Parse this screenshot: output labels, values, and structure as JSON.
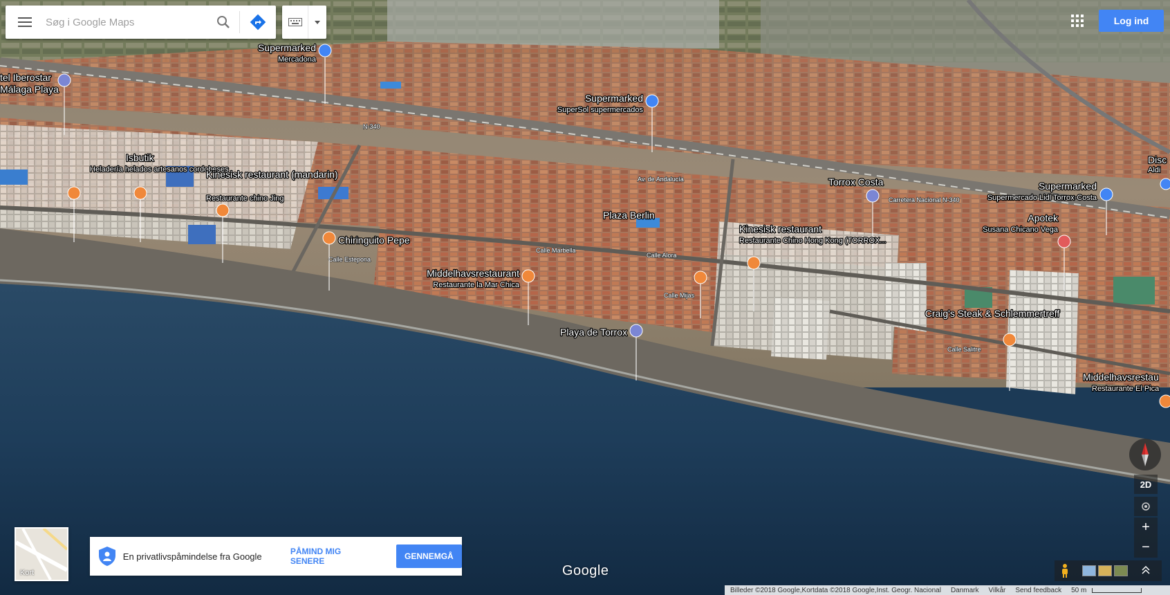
{
  "search": {
    "placeholder": "Søg i Google Maps"
  },
  "header": {
    "signin_label": "Log ind"
  },
  "pois": [
    {
      "name": "Supermarked",
      "sub": "Mercadona",
      "type": "shop"
    },
    {
      "name": "tel Iberostar",
      "sub": "Málaga Playa",
      "type": "hotel"
    },
    {
      "name": "Supermarked",
      "sub": "SuperSol supermercados",
      "type": "shop"
    },
    {
      "name": "Isbutik",
      "sub": "Heladería helados artesanos cordobeses",
      "type": "food"
    },
    {
      "name": "Kinesisk restaurant (mandarin)",
      "sub": "Restaurante chino Jing",
      "type": "food"
    },
    {
      "name": "Chiringuito Pepe",
      "sub": "",
      "type": "food"
    },
    {
      "name": "Middelhavsrestaurant",
      "sub": "Restaurante la Mar Chica",
      "type": "food"
    },
    {
      "name": "Plaza Berlin",
      "sub": "",
      "type": "place"
    },
    {
      "name": "Torrox Costa",
      "sub": "",
      "type": "hotel"
    },
    {
      "name": "Kinesisk restaurant",
      "sub": "Restaurante Chino Hong Kong (TORROX...",
      "type": "food"
    },
    {
      "name": "Playa de Torrox",
      "sub": "",
      "type": "beach"
    },
    {
      "name": "Supermarked",
      "sub": "Supermercado Lidl Torrox-Costa",
      "type": "shop"
    },
    {
      "name": "Apotek",
      "sub": "Susana Chicano Vega",
      "type": "pharmacy"
    },
    {
      "name": "Craig's Steak & Schlemmertreff",
      "sub": "",
      "type": "food"
    },
    {
      "name": "Middelhavsrestau",
      "sub": "Restaurante El Pica",
      "type": "food"
    },
    {
      "name": "Disc",
      "sub": "Aldi",
      "type": "shop"
    }
  ],
  "roads": [
    "N-340",
    "Av. de Andalucía",
    "Carretera Nacional N-340",
    "Calle Estepona",
    "Calle Alora",
    "Calle Mijas",
    "Calle Salitre",
    "Calle Marbella"
  ],
  "controls": {
    "tilt_label": "2D",
    "zoom_in": "+",
    "zoom_out": "−"
  },
  "layer": {
    "label": "Kort"
  },
  "privacy": {
    "text": "En privatlivspåmindelse fra Google",
    "later_label": "PÅMIND MIG SENERE",
    "review_label": "GENNEMGÅ"
  },
  "brand": {
    "logo_text": "Google"
  },
  "footer": {
    "attribution": "Billeder ©2018 Google,Kortdata ©2018 Google,Inst. Geogr. Nacional",
    "country": "Danmark",
    "terms": "Vilkår",
    "feedback": "Send feedback",
    "scale": "50 m"
  },
  "colors": {
    "accent": "#4285f4",
    "food_pin": "#f0883a",
    "shop_pin": "#4285f4",
    "pharmacy_pin": "#e25b5b",
    "sea": "#1c3a56"
  }
}
